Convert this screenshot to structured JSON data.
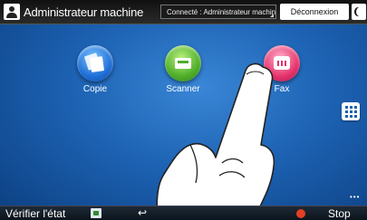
{
  "topbar": {
    "user_label": "Administrateur machine",
    "status_text": "Connecté : Administrateur machine",
    "logout_label": "Déconnexion"
  },
  "apps": [
    {
      "label": "Copie",
      "icon": "copy-icon",
      "color": "#1f6fd6"
    },
    {
      "label": "Scanner",
      "icon": "scanner-icon",
      "color": "#4fae2a"
    },
    {
      "label": "Fax",
      "icon": "fax-icon",
      "color": "#e5336b"
    }
  ],
  "bottombar": {
    "status_check_label": "Vérifier l'état",
    "stop_label": "Stop"
  },
  "colors": {
    "background": "#1d62b3",
    "topbar": "#1a1a1a",
    "stop": "#e33f25"
  }
}
